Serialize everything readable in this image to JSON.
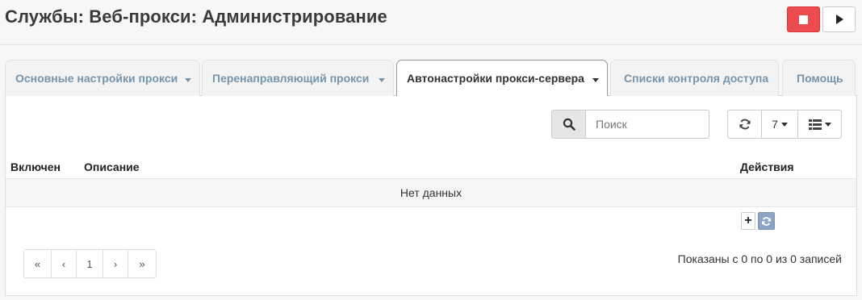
{
  "header": {
    "title": "Службы: Веб-прокси: Администрирование",
    "stop_icon": "stop-icon",
    "start_icon": "play-icon",
    "stop_color": "#ec4c4f"
  },
  "tabs": [
    {
      "label": "Основные настройки прокси",
      "has_dropdown": true,
      "active": false
    },
    {
      "label": "Перенаправляющий прокси",
      "has_dropdown": true,
      "active": false
    },
    {
      "label": "Автонастройки прокси-сервера",
      "has_dropdown": true,
      "active": true
    },
    {
      "label": "Списки контроля доступа",
      "has_dropdown": false,
      "active": false
    },
    {
      "label": "Помощь",
      "has_dropdown": false,
      "active": false
    }
  ],
  "toolbar": {
    "search_placeholder": "Поиск",
    "search_value": "",
    "rows_per_page": "7",
    "refresh_icon": "refresh-icon",
    "columns_icon": "columns-list-icon"
  },
  "table": {
    "columns": [
      "Включен",
      "Описание",
      "Действия"
    ],
    "empty_text": "Нет данных"
  },
  "actions": {
    "add_icon": "plus-icon",
    "reload_icon": "refresh-icon"
  },
  "pagination": {
    "first": "«",
    "prev": "‹",
    "current": "1",
    "next": "›",
    "last": "»"
  },
  "info": "Показаны с 0 по 0 из 0 записей"
}
